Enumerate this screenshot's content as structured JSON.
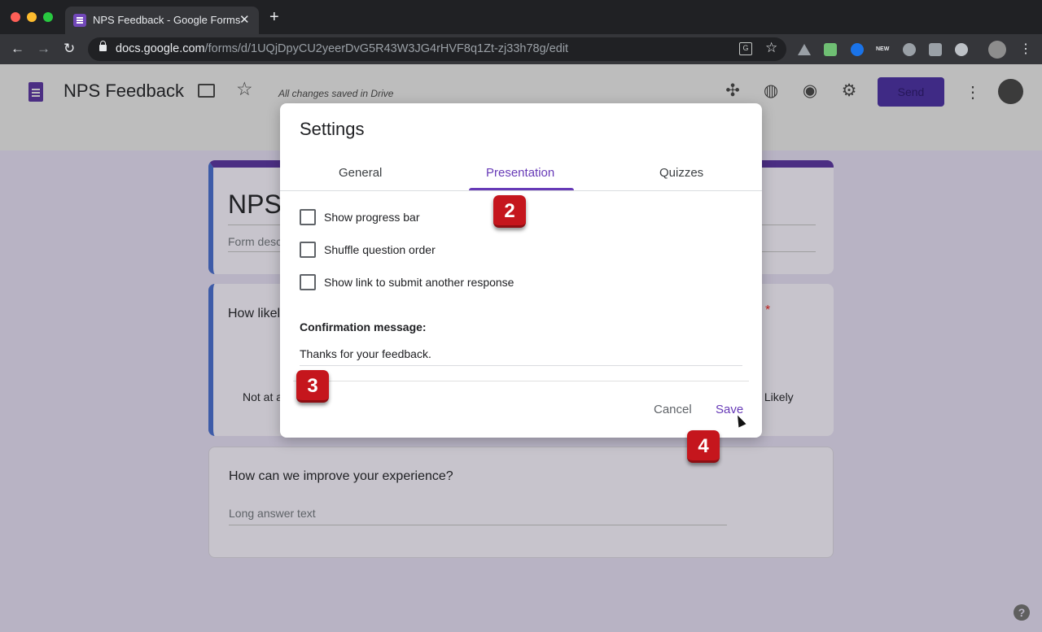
{
  "browser": {
    "tab_title": "NPS Feedback - Google Forms",
    "tab_close": "✕",
    "new_tab": "+",
    "url_host": "docs.google.com",
    "url_path": "/forms/d/1UQjDpyCU2yeerDvG5R43W3JG4rHVF8q1Zt-zj33h78g/edit",
    "nav_back": "←",
    "nav_forward": "→",
    "nav_reload": "↻",
    "bookmark": "☆",
    "translate": "G",
    "ext_new": "NEW",
    "menu": "⋮"
  },
  "header": {
    "title": "NPS Feedback",
    "star": "☆",
    "saved_status": "All changes saved in Drive",
    "send_label": "Send",
    "more": "⋮",
    "addon_icon": "✣",
    "palette_icon": "◍",
    "preview_icon": "◉",
    "gear_icon": "⚙"
  },
  "form": {
    "title": "NPS",
    "description_placeholder": "Form desc",
    "q1_text": "How likel",
    "q1_required": "*",
    "q1_low_label": "Not at a",
    "q1_high_label": "y Likely",
    "q2_text": "How can we improve your experience?",
    "q2_placeholder": "Long answer text"
  },
  "dialog": {
    "title": "Settings",
    "tabs": [
      {
        "label": "General"
      },
      {
        "label": "Presentation"
      },
      {
        "label": "Quizzes"
      }
    ],
    "options": [
      {
        "label": "Show progress bar",
        "checked": false
      },
      {
        "label": "Shuffle question order",
        "checked": false
      },
      {
        "label": "Show link to submit another response",
        "checked": false
      }
    ],
    "confirmation_label": "Confirmation message:",
    "confirmation_value": "Thanks for your feedback.",
    "cancel_label": "Cancel",
    "save_label": "Save"
  },
  "badges": [
    "2",
    "3",
    "4"
  ],
  "help": "?",
  "colors": {
    "accent": "#673ab7",
    "badge": "#c5161d"
  }
}
